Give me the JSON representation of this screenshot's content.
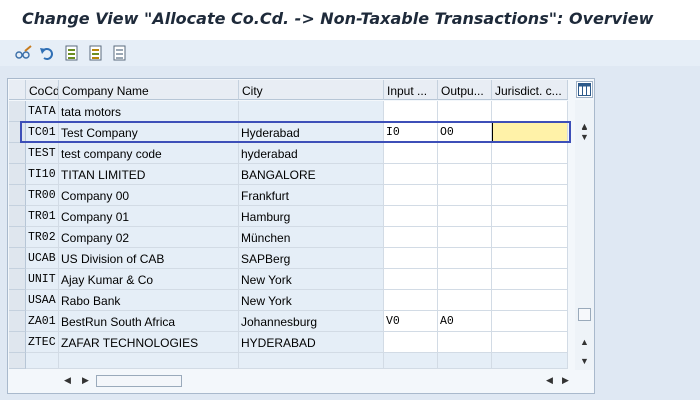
{
  "header": {
    "title": "Change View \"Allocate Co.Cd. -> Non-Taxable Transactions\": Overview"
  },
  "toolbar": {
    "icons": [
      "glasses-pencil-icon",
      "undo-icon",
      "select-all-icon",
      "select-block-icon",
      "deselect-all-icon"
    ]
  },
  "table": {
    "columns": [
      "CoCd",
      "Company Name",
      "City",
      "Input ...",
      "Outpu...",
      "Jurisdict. c..."
    ],
    "rows": [
      {
        "cocd": "TATA",
        "name": "tata motors",
        "city": "",
        "input": "",
        "output": "",
        "jur": ""
      },
      {
        "cocd": "TC01",
        "name": "Test Company",
        "city": "Hyderabad",
        "input": "I0",
        "output": "O0",
        "jur": ""
      },
      {
        "cocd": "TEST",
        "name": "test company code",
        "city": "hyderabad",
        "input": "",
        "output": "",
        "jur": ""
      },
      {
        "cocd": "TI10",
        "name": "TITAN LIMITED",
        "city": "BANGALORE",
        "input": "",
        "output": "",
        "jur": ""
      },
      {
        "cocd": "TR00",
        "name": "Company 00",
        "city": "Frankfurt",
        "input": "",
        "output": "",
        "jur": ""
      },
      {
        "cocd": "TR01",
        "name": "Company 01",
        "city": "Hamburg",
        "input": "",
        "output": "",
        "jur": ""
      },
      {
        "cocd": "TR02",
        "name": "Company 02",
        "city": "München",
        "input": "",
        "output": "",
        "jur": ""
      },
      {
        "cocd": "UCAB",
        "name": "US Division of CAB",
        "city": "SAPBerg",
        "input": "",
        "output": "",
        "jur": ""
      },
      {
        "cocd": "UNIT",
        "name": "Ajay Kumar & Co",
        "city": "New York",
        "input": "",
        "output": "",
        "jur": ""
      },
      {
        "cocd": "USAA",
        "name": "Rabo Bank",
        "city": "New York",
        "input": "",
        "output": "",
        "jur": ""
      },
      {
        "cocd": "ZA01",
        "name": "BestRun South Africa",
        "city": "Johannesburg",
        "input": "V0",
        "output": "A0",
        "jur": ""
      },
      {
        "cocd": "ZTEC",
        "name": "ZAFAR TECHNOLOGIES",
        "city": "HYDERABAD",
        "input": "",
        "output": "",
        "jur": ""
      },
      {
        "cocd": "",
        "name": "",
        "city": "",
        "input": "",
        "output": "",
        "jur": ""
      }
    ]
  },
  "colors": {
    "highlight": "#fff2a8",
    "selection_outline": "#3d4fb8"
  }
}
